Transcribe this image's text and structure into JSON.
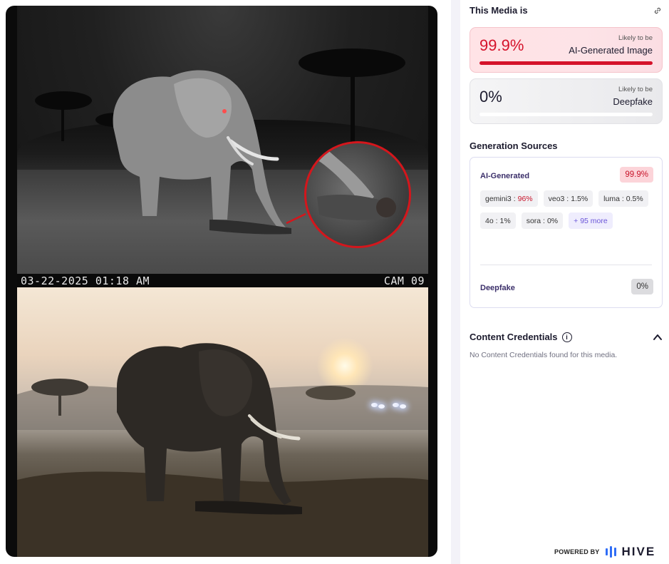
{
  "media": {
    "timestamp": "03-22-2025 01:18 AM",
    "camera_label": "CAM 09"
  },
  "panel": {
    "title": "This Media is",
    "link_icon": "link-icon",
    "ai_card": {
      "percent": "99.9%",
      "likely_label": "Likely to be",
      "verdict": "AI-Generated Image",
      "fill_fraction": 0.999,
      "color": "#d5122a"
    },
    "deepfake_card": {
      "percent": "0%",
      "likely_label": "Likely to be",
      "verdict": "Deepfake",
      "fill_fraction": 0
    },
    "sources": {
      "title": "Generation Sources",
      "ai_label": "AI-Generated",
      "ai_value": "99.9%",
      "chips": [
        {
          "name": "gemini3 :",
          "value": "96%",
          "hot": true
        },
        {
          "name": "veo3 :",
          "value": "1.5%",
          "hot": false
        },
        {
          "name": "luma :",
          "value": "0.5%",
          "hot": false
        },
        {
          "name": "4o :",
          "value": "1%",
          "hot": false
        },
        {
          "name": "sora :",
          "value": "0%",
          "hot": false
        }
      ],
      "more_label": "+ 95 more",
      "deepfake_label": "Deepfake",
      "deepfake_value": "0%"
    },
    "credentials": {
      "title": "Content Credentials",
      "note": "No Content Credentials found for this media."
    },
    "footer": {
      "powered_by": "POWERED BY",
      "brand": "HIVE"
    }
  }
}
